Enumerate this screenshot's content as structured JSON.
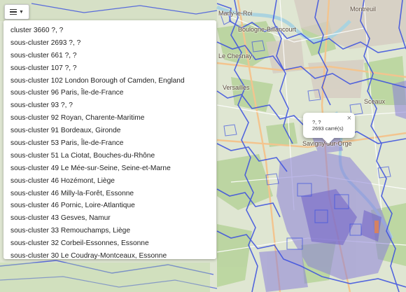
{
  "map": {
    "place_labels": [
      "Marly-le-Roi",
      "Boulogne-Billancourt",
      "Montreuil",
      "Sceaux",
      "Versailles",
      "Le Chesnay",
      "Savigny-sur-Orge"
    ],
    "colors": {
      "background": "#dfe6d2",
      "cluster_outline": "#3a4fe0",
      "cluster_fill": "#8a80d8"
    }
  },
  "controls": {
    "toggle_icon": "list-icon",
    "caret_icon": "caret-down-icon"
  },
  "cluster_list": [
    "cluster 3660 ?, ?",
    "sous-cluster 2693 ?, ?",
    "sous-cluster 661 ?, ?",
    "sous-cluster 107 ?, ?",
    "sous-cluster 102 London Borough of Camden, England",
    "sous-cluster 96 Paris, Île-de-France",
    "sous-cluster 93 ?, ?",
    "sous-cluster 92 Royan, Charente-Maritime",
    "sous-cluster 91 Bordeaux, Gironde",
    "sous-cluster 53 Paris, Île-de-France",
    "sous-cluster 51 La Ciotat, Bouches-du-Rhône",
    "sous-cluster 49 Le Mée-sur-Seine, Seine-et-Marne",
    "sous-cluster 46 Hozémont, Liège",
    "sous-cluster 46 Milly-la-Forêt, Essonne",
    "sous-cluster 46 Pornic, Loire-Atlantique",
    "sous-cluster 43 Gesves, Namur",
    "sous-cluster 33 Remouchamps, Liège",
    "sous-cluster 32 Corbeil-Essonnes, Essonne",
    "sous-cluster 30 Le Coudray-Montceaux, Essonne"
  ],
  "popup": {
    "line1": "?, ?",
    "line2": "2693 carré(s)",
    "close": "×"
  }
}
